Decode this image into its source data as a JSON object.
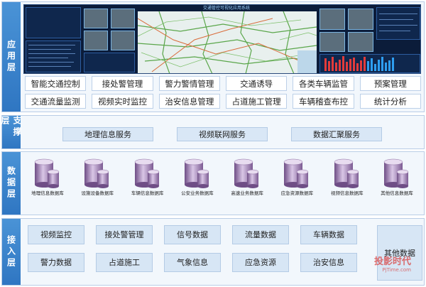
{
  "layers": {
    "app": {
      "label": "应用层",
      "dashboard_title": "交通管控可视化应用系统",
      "modules": [
        "智能交通控制",
        "接处警管理",
        "警力警情管理",
        "交通诱导",
        "各类车辆监管",
        "预案管理",
        "交通流量监测",
        "视频实时监控",
        "治安信息管理",
        "占道施工管理",
        "车辆稽查布控",
        "统计分析"
      ]
    },
    "support": {
      "label": "支撑层",
      "services": [
        "地理信息服务",
        "视频联网服务",
        "数据汇聚服务"
      ]
    },
    "data": {
      "label": "数据层",
      "databases": [
        "地理信息数据库",
        "设施设备数据库",
        "车辆信息数据库",
        "公安业务数据库",
        "高速业务数据库",
        "应急资源数据库",
        "视频信息数据库",
        "其他信息数据库"
      ]
    },
    "access": {
      "label": "接入层",
      "items": [
        "视频监控",
        "接处警管理",
        "信号数据",
        "流量数据",
        "车辆数据",
        "警力数据",
        "占道施工",
        "气象信息",
        "应急资源",
        "治安信息"
      ],
      "other": "其他数据"
    }
  },
  "watermark": {
    "line1": "投影时代",
    "line2": "PjTime.com"
  },
  "colors": {
    "label_bg": "#2f76c2",
    "dashboard_bg": "#0b1c3a",
    "bar_red": "#e23b3b",
    "bar_blue": "#2e9ef0"
  }
}
